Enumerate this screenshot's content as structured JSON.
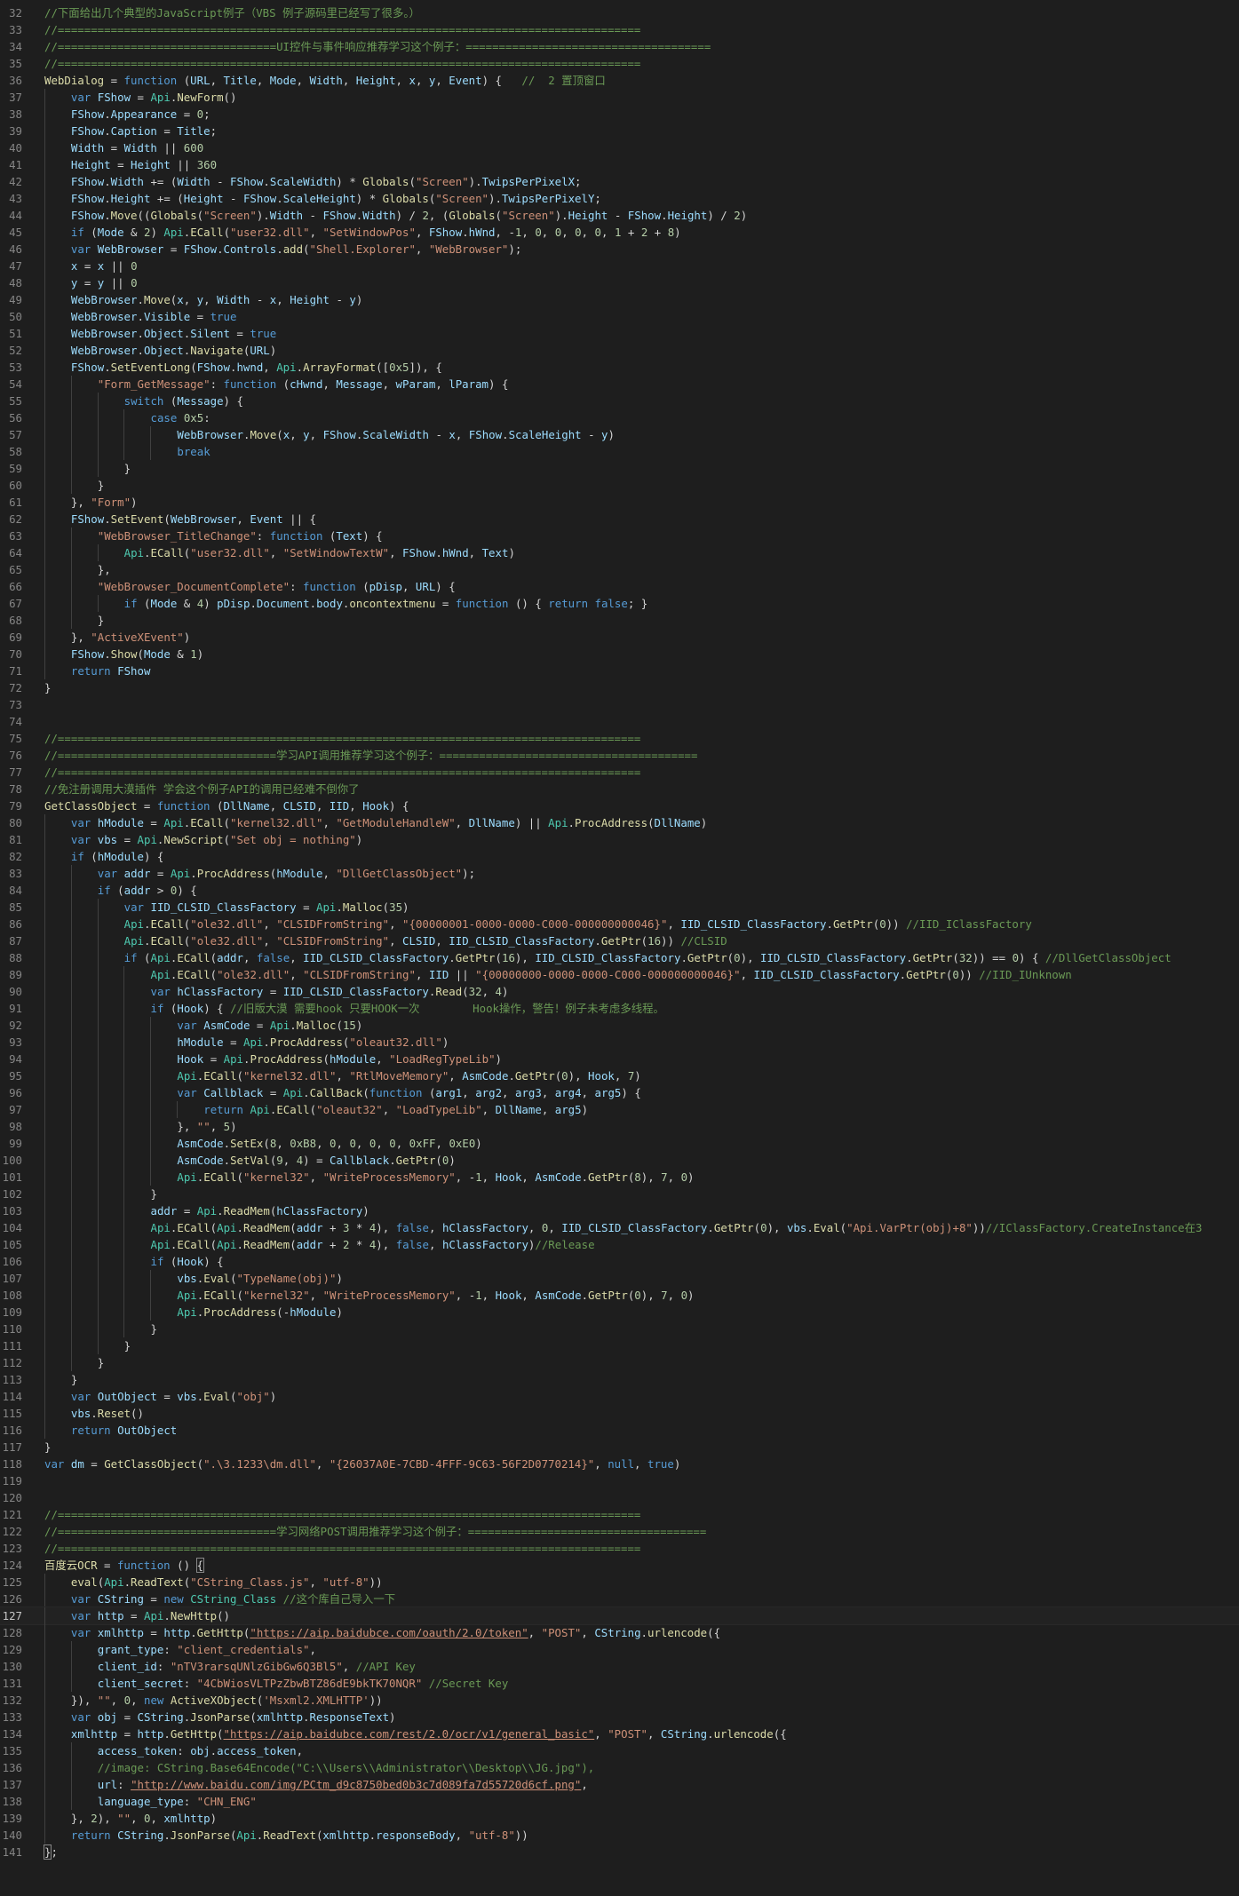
{
  "editor": {
    "theme": "dark",
    "colors": {
      "background": "#1e1e1e",
      "line_number": "#858585",
      "comment": "#6a9955",
      "keyword": "#569cd6",
      "string": "#ce9178",
      "number": "#b5cea8",
      "variable": "#9cdcfe",
      "function": "#dcdcaa",
      "type": "#4ec9b0"
    },
    "current_line": 127,
    "lines": [
      {
        "n": "32",
        "code": "//下面给出几个典型的JavaScript例子（VBS 例子源码里已经写了很多。）"
      },
      {
        "n": "33",
        "code": "//========================================================================================"
      },
      {
        "n": "34",
        "code": "//=================================UI控件与事件响应推荐学习这个例子：====================================="
      },
      {
        "n": "35",
        "code": "//========================================================================================"
      },
      {
        "n": "36",
        "code": "WebDialog = function (URL, Title, Mode, Width, Height, x, y, Event) {   //  2 置顶窗口"
      },
      {
        "n": "37",
        "code": "    var FShow = Api.NewForm()"
      },
      {
        "n": "38",
        "code": "    FShow.Appearance = 0;"
      },
      {
        "n": "39",
        "code": "    FShow.Caption = Title;"
      },
      {
        "n": "40",
        "code": "    Width = Width || 600"
      },
      {
        "n": "41",
        "code": "    Height = Height || 360"
      },
      {
        "n": "42",
        "code": "    FShow.Width += (Width - FShow.ScaleWidth) * Globals(\"Screen\").TwipsPerPixelX;"
      },
      {
        "n": "43",
        "code": "    FShow.Height += (Height - FShow.ScaleHeight) * Globals(\"Screen\").TwipsPerPixelY;"
      },
      {
        "n": "44",
        "code": "    FShow.Move((Globals(\"Screen\").Width - FShow.Width) / 2, (Globals(\"Screen\").Height - FShow.Height) / 2)"
      },
      {
        "n": "45",
        "code": "    if (Mode & 2) Api.ECall(\"user32.dll\", \"SetWindowPos\", FShow.hWnd, -1, 0, 0, 0, 0, 1 + 2 + 8)"
      },
      {
        "n": "46",
        "code": "    var WebBrowser = FShow.Controls.add(\"Shell.Explorer\", \"WebBrowser\");"
      },
      {
        "n": "47",
        "code": "    x = x || 0"
      },
      {
        "n": "48",
        "code": "    y = y || 0"
      },
      {
        "n": "49",
        "code": "    WebBrowser.Move(x, y, Width - x, Height - y)"
      },
      {
        "n": "50",
        "code": "    WebBrowser.Visible = true"
      },
      {
        "n": "51",
        "code": "    WebBrowser.Object.Silent = true"
      },
      {
        "n": "52",
        "code": "    WebBrowser.Object.Navigate(URL)"
      },
      {
        "n": "53",
        "code": "    FShow.SetEventLong(FShow.hwnd, Api.ArrayFormat([0x5]), {"
      },
      {
        "n": "54",
        "code": "        \"Form_GetMessage\": function (cHwnd, Message, wParam, lParam) {"
      },
      {
        "n": "55",
        "code": "            switch (Message) {"
      },
      {
        "n": "56",
        "code": "                case 0x5:"
      },
      {
        "n": "57",
        "code": "                    WebBrowser.Move(x, y, FShow.ScaleWidth - x, FShow.ScaleHeight - y)"
      },
      {
        "n": "58",
        "code": "                    break"
      },
      {
        "n": "59",
        "code": "            }"
      },
      {
        "n": "60",
        "code": "        }"
      },
      {
        "n": "61",
        "code": "    }, \"Form\")"
      },
      {
        "n": "62",
        "code": "    FShow.SetEvent(WebBrowser, Event || {"
      },
      {
        "n": "63",
        "code": "        \"WebBrowser_TitleChange\": function (Text) {"
      },
      {
        "n": "64",
        "code": "            Api.ECall(\"user32.dll\", \"SetWindowTextW\", FShow.hWnd, Text)"
      },
      {
        "n": "65",
        "code": "        },"
      },
      {
        "n": "66",
        "code": "        \"WebBrowser_DocumentComplete\": function (pDisp, URL) {"
      },
      {
        "n": "67",
        "code": "            if (Mode & 4) pDisp.Document.body.oncontextmenu = function () { return false; }"
      },
      {
        "n": "68",
        "code": "        }"
      },
      {
        "n": "69",
        "code": "    }, \"ActiveXEvent\")"
      },
      {
        "n": "70",
        "code": "    FShow.Show(Mode & 1)"
      },
      {
        "n": "71",
        "code": "    return FShow"
      },
      {
        "n": "72",
        "code": "}"
      },
      {
        "n": "73",
        "code": ""
      },
      {
        "n": "74",
        "code": ""
      },
      {
        "n": "75",
        "code": "//========================================================================================"
      },
      {
        "n": "76",
        "code": "//=================================学习API调用推荐学习这个例子：======================================="
      },
      {
        "n": "77",
        "code": "//========================================================================================"
      },
      {
        "n": "78",
        "code": "//免注册调用大漠插件 学会这个例子API的调用已经难不倒你了"
      },
      {
        "n": "79",
        "code": "GetClassObject = function (DllName, CLSID, IID, Hook) {"
      },
      {
        "n": "80",
        "code": "    var hModule = Api.ECall(\"kernel32.dll\", \"GetModuleHandleW\", DllName) || Api.ProcAddress(DllName)"
      },
      {
        "n": "81",
        "code": "    var vbs = Api.NewScript(\"Set obj = nothing\")"
      },
      {
        "n": "82",
        "code": "    if (hModule) {"
      },
      {
        "n": "83",
        "code": "        var addr = Api.ProcAddress(hModule, \"DllGetClassObject\");"
      },
      {
        "n": "84",
        "code": "        if (addr > 0) {"
      },
      {
        "n": "85",
        "code": "            var IID_CLSID_ClassFactory = Api.Malloc(35)"
      },
      {
        "n": "86",
        "code": "            Api.ECall(\"ole32.dll\", \"CLSIDFromString\", \"{00000001-0000-0000-C000-000000000046}\", IID_CLSID_ClassFactory.GetPtr(0)) //IID_IClassFactory"
      },
      {
        "n": "87",
        "code": "            Api.ECall(\"ole32.dll\", \"CLSIDFromString\", CLSID, IID_CLSID_ClassFactory.GetPtr(16)) //CLSID"
      },
      {
        "n": "88",
        "code": "            if (Api.ECall(addr, false, IID_CLSID_ClassFactory.GetPtr(16), IID_CLSID_ClassFactory.GetPtr(0), IID_CLSID_ClassFactory.GetPtr(32)) == 0) { //DllGetClassObject"
      },
      {
        "n": "89",
        "code": "                Api.ECall(\"ole32.dll\", \"CLSIDFromString\", IID || \"{00000000-0000-0000-C000-000000000046}\", IID_CLSID_ClassFactory.GetPtr(0)) //IID_IUnknown"
      },
      {
        "n": "90",
        "code": "                var hClassFactory = IID_CLSID_ClassFactory.Read(32, 4)"
      },
      {
        "n": "91",
        "code": "                if (Hook) { //旧版大漠 需要hook 只要HOOK一次        Hook操作，警告！例子未考虑多线程。"
      },
      {
        "n": "92",
        "code": "                    var AsmCode = Api.Malloc(15)"
      },
      {
        "n": "93",
        "code": "                    hModule = Api.ProcAddress(\"oleaut32.dll\")"
      },
      {
        "n": "94",
        "code": "                    Hook = Api.ProcAddress(hModule, \"LoadRegTypeLib\")"
      },
      {
        "n": "95",
        "code": "                    Api.ECall(\"kernel32.dll\", \"RtlMoveMemory\", AsmCode.GetPtr(0), Hook, 7)"
      },
      {
        "n": "96",
        "code": "                    var Callblack = Api.CallBack(function (arg1, arg2, arg3, arg4, arg5) {"
      },
      {
        "n": "97",
        "code": "                        return Api.ECall(\"oleaut32\", \"LoadTypeLib\", DllName, arg5)"
      },
      {
        "n": "98",
        "code": "                    }, \"\", 5)"
      },
      {
        "n": "99",
        "code": "                    AsmCode.SetEx(8, 0xB8, 0, 0, 0, 0, 0xFF, 0xE0)"
      },
      {
        "n": "100",
        "code": "                    AsmCode.SetVal(9, 4) = Callblack.GetPtr(0)"
      },
      {
        "n": "101",
        "code": "                    Api.ECall(\"kernel32\", \"WriteProcessMemory\", -1, Hook, AsmCode.GetPtr(8), 7, 0)"
      },
      {
        "n": "102",
        "code": "                }"
      },
      {
        "n": "103",
        "code": "                addr = Api.ReadMem(hClassFactory)"
      },
      {
        "n": "104",
        "code": "                Api.ECall(Api.ReadMem(addr + 3 * 4), false, hClassFactory, 0, IID_CLSID_ClassFactory.GetPtr(0), vbs.Eval(\"Api.VarPtr(obj)+8\"))//IClassFactory.CreateInstance在3"
      },
      {
        "n": "105",
        "code": "                Api.ECall(Api.ReadMem(addr + 2 * 4), false, hClassFactory)//Release"
      },
      {
        "n": "106",
        "code": "                if (Hook) {"
      },
      {
        "n": "107",
        "code": "                    vbs.Eval(\"TypeName(obj)\")"
      },
      {
        "n": "108",
        "code": "                    Api.ECall(\"kernel32\", \"WriteProcessMemory\", -1, Hook, AsmCode.GetPtr(0), 7, 0)"
      },
      {
        "n": "109",
        "code": "                    Api.ProcAddress(-hModule)"
      },
      {
        "n": "110",
        "code": "                }"
      },
      {
        "n": "111",
        "code": "            }"
      },
      {
        "n": "112",
        "code": "        }"
      },
      {
        "n": "113",
        "code": "    }"
      },
      {
        "n": "114",
        "code": "    var OutObject = vbs.Eval(\"obj\")"
      },
      {
        "n": "115",
        "code": "    vbs.Reset()"
      },
      {
        "n": "116",
        "code": "    return OutObject"
      },
      {
        "n": "117",
        "code": "}"
      },
      {
        "n": "118",
        "code": "var dm = GetClassObject(\".\\3.1233\\dm.dll\", \"{26037A0E-7CBD-4FFF-9C63-56F2D0770214}\", null, true)"
      },
      {
        "n": "119",
        "code": ""
      },
      {
        "n": "120",
        "code": ""
      },
      {
        "n": "121",
        "code": "//========================================================================================"
      },
      {
        "n": "122",
        "code": "//=================================学习网络POST调用推荐学习这个例子：===================================="
      },
      {
        "n": "123",
        "code": "//========================================================================================"
      },
      {
        "n": "124",
        "code": "百度云OCR = function () {"
      },
      {
        "n": "125",
        "code": "    eval(Api.ReadText(\"CString_Class.js\", \"utf-8\"))"
      },
      {
        "n": "126",
        "code": "    var CString = new CString_Class //这个库自己导入一下"
      },
      {
        "n": "127",
        "code": "    var http = Api.NewHttp()"
      },
      {
        "n": "128",
        "code": "    var xmlhttp = http.GetHttp(\"https://aip.baidubce.com/oauth/2.0/token\", \"POST\", CString.urlencode({"
      },
      {
        "n": "129",
        "code": "        grant_type: \"client_credentials\","
      },
      {
        "n": "130",
        "code": "        client_id: \"nTV3rarsqUNlzGibGw6Q3Bl5\", //API Key"
      },
      {
        "n": "131",
        "code": "        client_secret: \"4CbWiosVLTPzZbwBTZ86dE9bkTK70NQR\" //Secret Key"
      },
      {
        "n": "132",
        "code": "    }), \"\", 0, new ActiveXObject('Msxml2.XMLHTTP'))"
      },
      {
        "n": "133",
        "code": "    var obj = CString.JsonParse(xmlhttp.ResponseText)"
      },
      {
        "n": "134",
        "code": "    xmlhttp = http.GetHttp(\"https://aip.baidubce.com/rest/2.0/ocr/v1/general_basic\", \"POST\", CString.urlencode({"
      },
      {
        "n": "135",
        "code": "        access_token: obj.access_token,"
      },
      {
        "n": "136",
        "code": "        //image: CString.Base64Encode(\"C:\\\\Users\\\\Administrator\\\\Desktop\\\\JG.jpg\"),"
      },
      {
        "n": "137",
        "code": "        url: \"http://www.baidu.com/img/PCtm_d9c8750bed0b3c7d089fa7d55720d6cf.png\","
      },
      {
        "n": "138",
        "code": "        language_type: \"CHN_ENG\""
      },
      {
        "n": "139",
        "code": "    }, 2), \"\", 0, xmlhttp)"
      },
      {
        "n": "140",
        "code": "    return CString.JsonParse(Api.ReadText(xmlhttp.responseBody, \"utf-8\"))"
      },
      {
        "n": "141",
        "code": "};"
      }
    ]
  }
}
